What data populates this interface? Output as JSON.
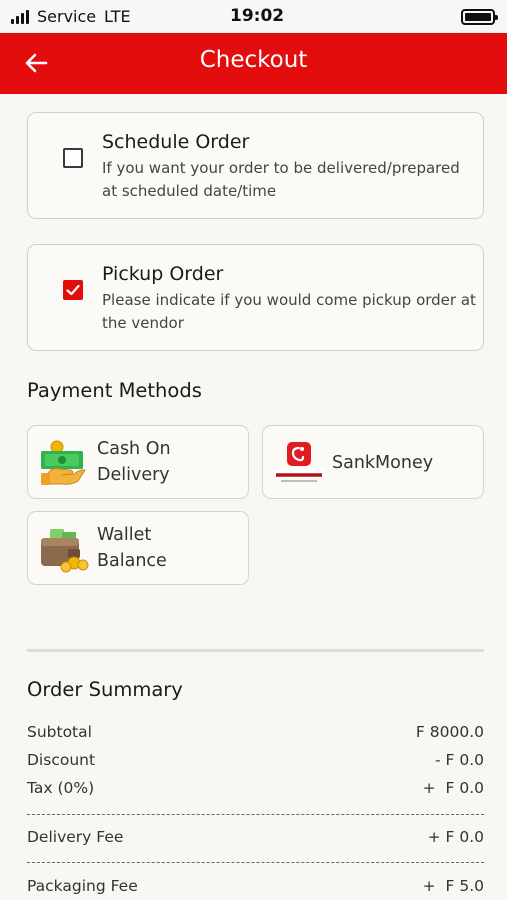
{
  "status_bar": {
    "carrier": "Service",
    "network": "LTE",
    "time": "19:02"
  },
  "header": {
    "title": "Checkout"
  },
  "order_options": [
    {
      "title": "Schedule Order",
      "description": "If you want your order to be delivered/prepared at scheduled date/time",
      "checked": false
    },
    {
      "title": "Pickup Order",
      "description": "Please indicate if you would come pickup order at the vendor",
      "checked": true
    }
  ],
  "payment": {
    "title": "Payment Methods",
    "methods": [
      {
        "label_line1": "Cash On",
        "label_line2": "Delivery",
        "icon": "cash-hand-icon"
      },
      {
        "label_line1": "SankMoney",
        "icon": "sankmoney-logo"
      },
      {
        "label_line1": "Wallet",
        "label_line2": "Balance",
        "icon": "wallet-icon"
      }
    ]
  },
  "summary": {
    "title": "Order Summary",
    "rows": [
      {
        "label": "Subtotal",
        "value": "F 8000.0"
      },
      {
        "label": "Discount",
        "value": "- F 0.0"
      },
      {
        "label": "Tax (0%)",
        "value": "+  F 0.0"
      },
      {
        "label": "Delivery Fee",
        "value": "+ F 0.0"
      },
      {
        "label": "Packaging Fee",
        "value": "+  F 5.0"
      }
    ]
  },
  "colors": {
    "brand": "#e30d0d",
    "background": "#f8f7f4",
    "card_border": "#cfcfcf"
  }
}
